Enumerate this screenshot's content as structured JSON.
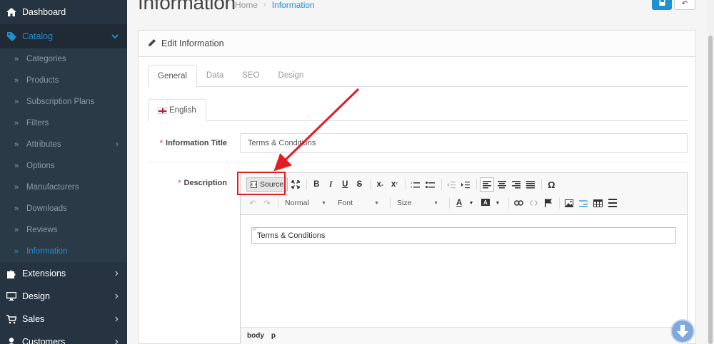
{
  "sidebar": {
    "dashboard": "Dashboard",
    "catalog": "Catalog",
    "catalog_items": [
      {
        "label": "Categories",
        "active": false,
        "has_children": false
      },
      {
        "label": "Products",
        "active": false,
        "has_children": false
      },
      {
        "label": "Subscription Plans",
        "active": false,
        "has_children": false
      },
      {
        "label": "Filters",
        "active": false,
        "has_children": false
      },
      {
        "label": "Attributes",
        "active": false,
        "has_children": true
      },
      {
        "label": "Options",
        "active": false,
        "has_children": false
      },
      {
        "label": "Manufacturers",
        "active": false,
        "has_children": false
      },
      {
        "label": "Downloads",
        "active": false,
        "has_children": false
      },
      {
        "label": "Reviews",
        "active": false,
        "has_children": false
      },
      {
        "label": "Information",
        "active": true,
        "has_children": false
      }
    ],
    "main_items": [
      {
        "label": "Extensions",
        "icon": "puzzle-icon"
      },
      {
        "label": "Design",
        "icon": "monitor-icon"
      },
      {
        "label": "Sales",
        "icon": "cart-icon"
      },
      {
        "label": "Customers",
        "icon": "user-icon"
      }
    ]
  },
  "header": {
    "title": "Information",
    "breadcrumb": [
      "Home",
      "Information"
    ]
  },
  "panel": {
    "heading": "Edit Information",
    "tabs": [
      {
        "label": "General",
        "active": true
      },
      {
        "label": "Data",
        "active": false
      },
      {
        "label": "SEO",
        "active": false
      },
      {
        "label": "Design",
        "active": false
      }
    ],
    "language_tab": "English",
    "fields": {
      "title_label": "Information Title",
      "title_value": "Terms & Conditions",
      "description_label": "Description"
    }
  },
  "editor": {
    "source_label": "Source",
    "format_combo": "Normal",
    "font_combo": "Font",
    "size_combo": "Size",
    "content": "Terms & Conditions",
    "block_tag": "P",
    "path": [
      "body",
      "p"
    ]
  },
  "colors": {
    "sidebar_bg": "#2b3a47",
    "accent": "#1e91cf",
    "highlight_red": "#e51b24"
  }
}
